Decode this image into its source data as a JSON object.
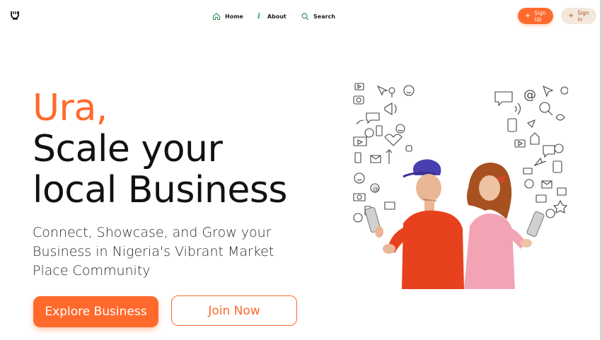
{
  "nav": {
    "home_label": "Home",
    "about_label": "About",
    "search_label": "Search"
  },
  "auth": {
    "signup_label": "Sign Up",
    "signin_label": "Sign in"
  },
  "hero": {
    "accent": "Ura,",
    "title_line1": "Scale your",
    "title_line2": "local Business",
    "subtitle": "Connect, Showcase, and Grow your Business in Nigeria's Vibrant Market Place Community",
    "explore_label": "Explore Business",
    "join_label": "Join Now"
  },
  "colors": {
    "accent": "#ff6a2c",
    "signin_bg": "#f3e8dc",
    "text": "#111111"
  }
}
